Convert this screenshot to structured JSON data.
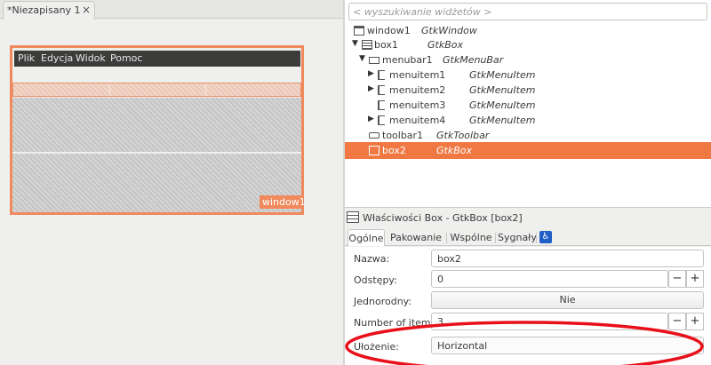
{
  "left_tab": {
    "label": "*Niezapisany 1",
    "close": "×"
  },
  "preview": {
    "menu": [
      "Plik",
      "Edycja",
      "Widok",
      "Pomoc"
    ],
    "badge": "window1"
  },
  "search": {
    "placeholder": "< wyszukiwanie widżetów >"
  },
  "tree": [
    {
      "name": "window1",
      "class": "GtkWindow",
      "icon": "window-icon",
      "expander": ""
    },
    {
      "name": "box1",
      "class": "GtkBox",
      "icon": "box-icon",
      "expander": "▼"
    },
    {
      "name": "menubar1",
      "class": "GtkMenuBar",
      "icon": "menubar-icon",
      "expander": "▼"
    },
    {
      "name": "menuitem1",
      "class": "GtkMenuItem",
      "icon": "menuitem-icon",
      "expander": "▶"
    },
    {
      "name": "menuitem2",
      "class": "GtkMenuItem",
      "icon": "menuitem-icon",
      "expander": "▶"
    },
    {
      "name": "menuitem3",
      "class": "GtkMenuItem",
      "icon": "menuitem-icon",
      "expander": ""
    },
    {
      "name": "menuitem4",
      "class": "GtkMenuItem",
      "icon": "menuitem-icon",
      "expander": "▶"
    },
    {
      "name": "toolbar1",
      "class": "GtkToolbar",
      "icon": "toolbar-icon",
      "expander": ""
    },
    {
      "name": "box2",
      "class": "GtkBox",
      "icon": "box-icon",
      "expander": "",
      "selected": true
    }
  ],
  "props": {
    "title": "Właściwości Box - GtkBox [box2]",
    "tabs": [
      "Ogólne",
      "Pakowanie",
      "Wspólne",
      "Sygnały"
    ],
    "name_label": "Nazwa:",
    "name_value": "box2",
    "spacing_label": "Odstępy:",
    "spacing_value": "0",
    "homogeneous_label": "Jednorodny:",
    "homogeneous_value": "Nie",
    "items_label": "Number of items:",
    "items_value": "3",
    "orientation_label": "Ułożenie:",
    "orientation_value": "Horizontal",
    "minus": "−",
    "plus": "+"
  },
  "colors": {
    "accent": "#f07843",
    "annotation": "#e8101a"
  }
}
